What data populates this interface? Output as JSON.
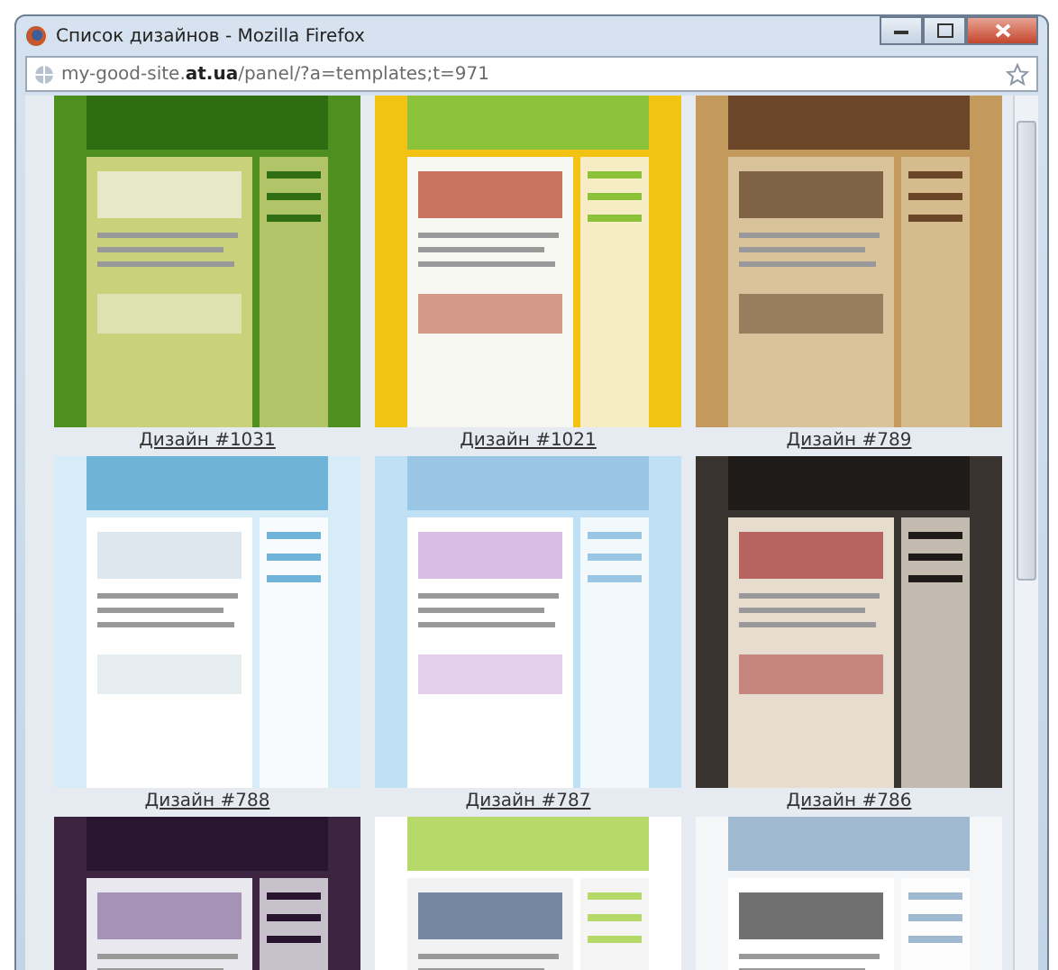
{
  "window": {
    "title": "Список дизайнов - Mozilla Firefox"
  },
  "address_bar": {
    "url": "my-good-site.**at.ua**/panel/?a=templates;t=971"
  },
  "designs": [
    {
      "kind": "picture",
      "caption": "Дизайн #1031"
    },
    {
      "kind": "picture",
      "caption": "Дизайн #1021"
    },
    {
      "kind": "picture",
      "caption": "Дизайн #789"
    },
    {
      "kind": "picture",
      "caption": "Дизайн #788"
    },
    {
      "kind": "picture",
      "caption": "Дизайн #787"
    },
    {
      "kind": "picture",
      "caption": "Дизайн #786"
    },
    {
      "kind": "picture"
    },
    {
      "kind": "picture"
    },
    {
      "kind": "picture"
    }
  ]
}
